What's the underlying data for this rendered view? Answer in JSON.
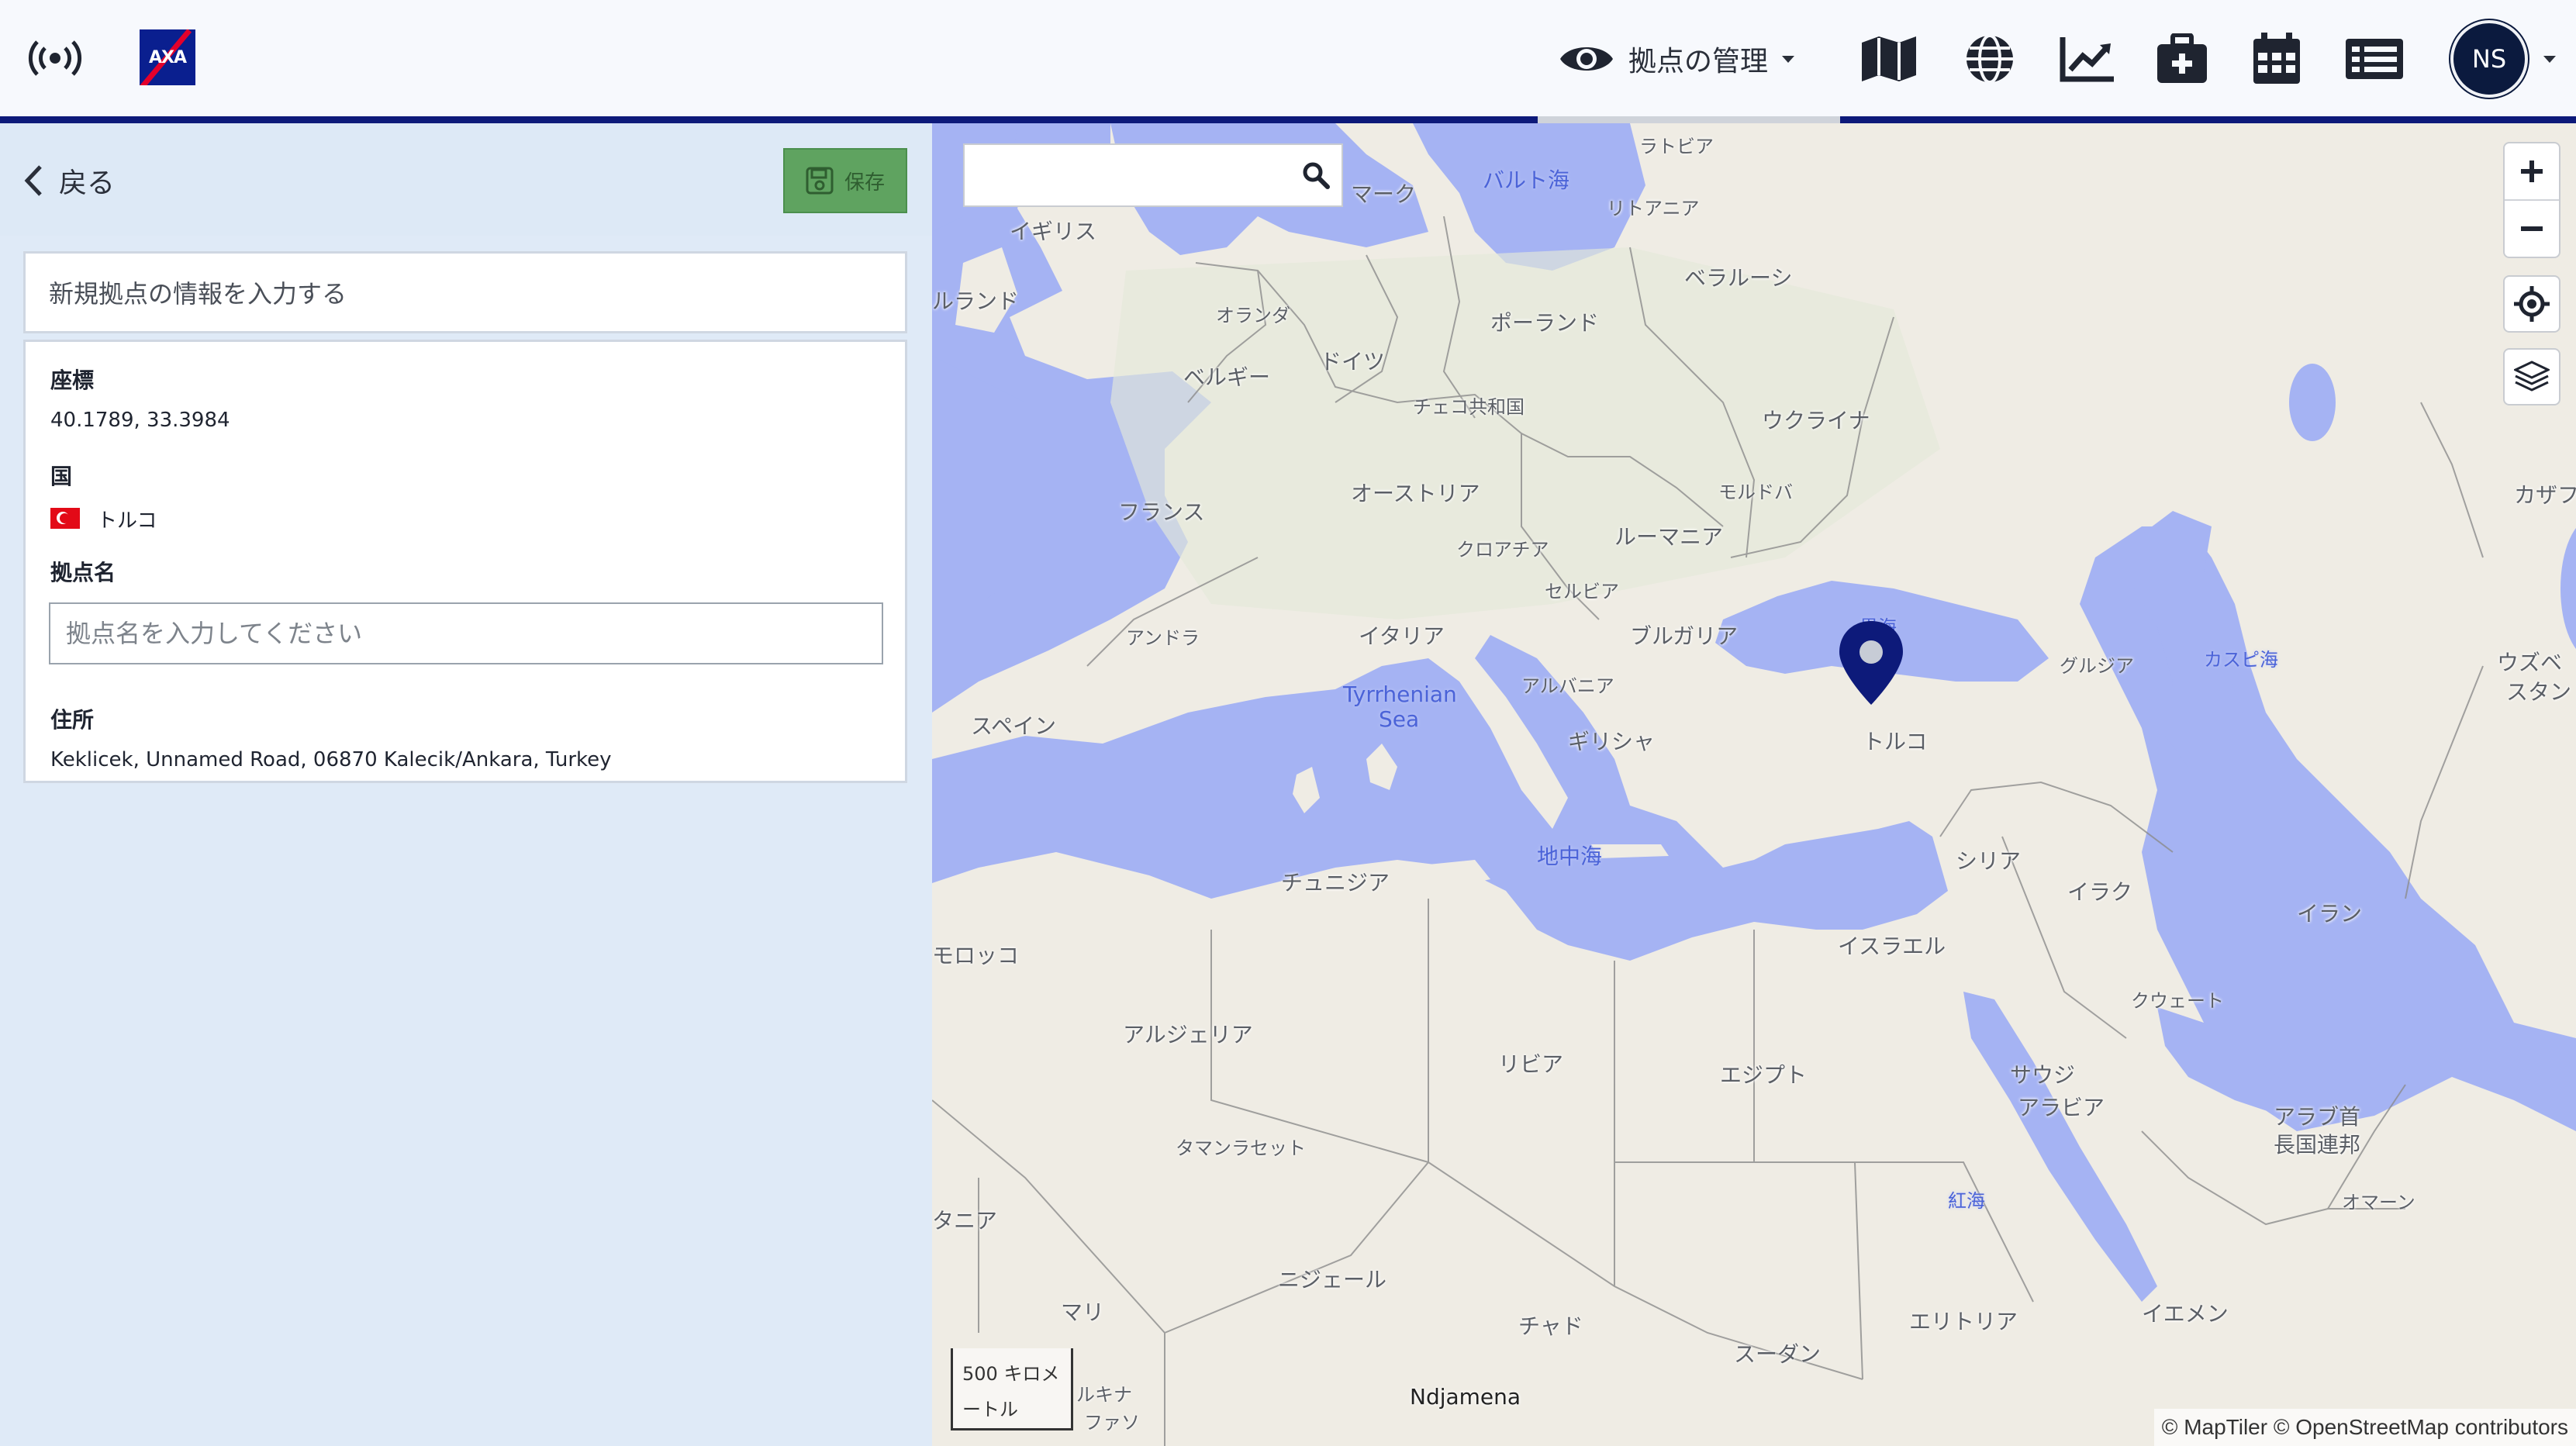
{
  "header": {
    "site_menu_label": "拠点の管理",
    "icons": [
      "broadcast-icon",
      "axa-logo",
      "eye-icon",
      "map-icon",
      "globe-icon",
      "chart-line-icon",
      "medical-kit-icon",
      "calendar-icon",
      "list-icon"
    ],
    "user_initials": "NS",
    "logo_text": "AXA",
    "colors": {
      "nav_bar": "#0d1a7a",
      "avatar": "#0b1a3e",
      "save_button": "#5fa360"
    }
  },
  "panel": {
    "back_label": "戻る",
    "save_label": "保存",
    "card_title": "新規拠点の情報を入力する",
    "coordinates_label": "座標",
    "coordinates_value": "40.1789, 33.3984",
    "country_label": "国",
    "country_value": "トルコ",
    "site_name_label": "拠点名",
    "site_name_placeholder": "拠点名を入力してください",
    "site_name_value": "",
    "address_label": "住所",
    "address_value": "Keklicek, Unnamed Road, 06870 Kalecik/Ankara, Turkey"
  },
  "map": {
    "search_placeholder": "",
    "scale_label_1": "500 キロメ",
    "scale_label_2": "ートル",
    "attribution": "© MapTiler © OpenStreetMap contributors",
    "labels": {
      "latvia": "ラトビア",
      "baltic_sea": "バルト海",
      "denmark": "マーク",
      "lithuania": "リトアニア",
      "uk": "イギリス",
      "belarus": "ベラルーシ",
      "ireland": "ルランド",
      "netherlands": "オランダ",
      "poland": "ポーランド",
      "germany": "ドイツ",
      "belgium": "ベルギー",
      "czech": "チェコ共和国",
      "ukraine": "ウクライナ",
      "austria": "オーストリア",
      "moldova": "モルドバ",
      "france": "フランス",
      "kazakhstan": "カザフ",
      "croatia": "クロアチア",
      "romania": "ルーマニア",
      "serbia": "セルビア",
      "andorra": "アンドラ",
      "italy": "イタリア",
      "bulgaria": "ブルガリア",
      "black_sea": "黒海",
      "georgia": "グルジア",
      "caspian_sea": "カスピ海",
      "uzbekistan_1": "ウズベ",
      "uzbekistan_2": "スタン",
      "albania": "アルバニア",
      "tyrrhenian_1": "Tyrrhenian",
      "tyrrhenian_2": "Sea",
      "spain": "スペイン",
      "greece": "ギリシャ",
      "turkey": "トルコ",
      "mediterranean": "地中海",
      "syria": "シリア",
      "tunisia": "チュニジア",
      "iraq": "イラク",
      "iran": "イラン",
      "morocco": "モロッコ",
      "israel": "イスラエル",
      "kuwait": "クウェート",
      "algeria": "アルジェリア",
      "libya": "リビア",
      "egypt": "エジプト",
      "saudi_1": "サウジ",
      "saudi_2": "アラビア",
      "uae_1": "アラブ首",
      "uae_2": "長国連邦",
      "tamanrasset": "タマンラセット",
      "red_sea": "紅海",
      "oman": "オマーン",
      "mauritania": "タニア",
      "niger": "ニジェール",
      "mali": "マリ",
      "chad": "チャド",
      "eritrea": "エリトリア",
      "yemen": "イエメン",
      "sudan": "スーダン",
      "burkina_1": "ルキナ",
      "burkina_2": "ファソ",
      "ndjamena": "Ndjamena"
    }
  }
}
